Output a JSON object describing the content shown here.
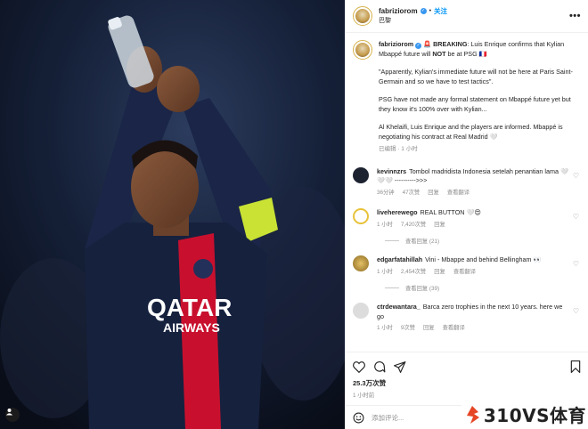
{
  "post": {
    "username": "fabriziorom",
    "follow_label": "关注",
    "separator": "•",
    "location": "巴黎",
    "more_label": "•••",
    "image_alt": "Kylian Mbappé applauding in a PSG Qatar Airways jersey holding a water bottle",
    "jersey_text_1": "QATAR",
    "jersey_text_2": "AIRWAYS"
  },
  "caption": {
    "username": "fabriziorom",
    "line1_prefix": "🚨",
    "line1_breaking": "BREAKING",
    "line1_rest": ": Luis Enrique confirms that Kylian Mbappé future will",
    "line1_not": "NOT",
    "line1_end": "be at PSG",
    "line1_flag": "🇫🇷",
    "para2": "\"Apparently, Kylian's immediate future will not be here at Paris Saint-Germain and so we have to test tactics\".",
    "para3": "PSG have not made any formal statement on Mbappé future yet but they know it's 100% over with Kylian...",
    "para4": "Al Khelaifi, Luis Enrique and the players are informed. Mbappé is negotiating his contract at Real Madrid 🤍",
    "meta": "已编辑 · 1 小时"
  },
  "comments": [
    {
      "username": "kevinnzrs",
      "text": "Tombol madridista Indonesia setelah penantian lama 🤍🤍🤍 ---------->>>",
      "time": "36分钟",
      "likes": "47次赞",
      "reply_label": "回复",
      "translate_label": "查看翻译",
      "avatar_color": "#1c2230"
    },
    {
      "username": "liveherewego",
      "text": "REAL BUTTON 🤍😍",
      "time": "1 小时",
      "likes": "7,420次赞",
      "reply_label": "回复",
      "translate_label": "",
      "replies_label": "查看回复 (21)",
      "avatar_color": "#e8c23a"
    },
    {
      "username": "edgarfatahillah",
      "text": "Vini - Mbappe and behind Bellingham 👀",
      "time": "1 小时",
      "likes": "2,454次赞",
      "reply_label": "回复",
      "translate_label": "查看翻译",
      "replies_label": "查看回复 (39)",
      "avatar_color": "#c9a13a"
    },
    {
      "username": "ctrdewantara_",
      "text": "Barca zero trophies in the next 10 years. here we go",
      "time": "1 小时",
      "likes": "9次赞",
      "reply_label": "回复",
      "translate_label": "查看翻译",
      "avatar_color": "#d9d9d9"
    }
  ],
  "actions": {
    "likes": "25.3万次赞",
    "time": "1 小时前"
  },
  "composer": {
    "placeholder": "添加评论..."
  },
  "watermark": {
    "text": "310VS体育"
  },
  "icons": [
    "heart-icon",
    "comment-icon",
    "share-icon",
    "bookmark-icon",
    "emoji-icon",
    "more-icon",
    "user-tag-icon",
    "verified-icon"
  ],
  "colors": {
    "accent": "#0095f6",
    "secondary_text": "#8e8e8e",
    "verified": "#3897f0",
    "jersey_navy": "#16213e",
    "jersey_red": "#c8102e",
    "captain_band": "#c9e234"
  }
}
